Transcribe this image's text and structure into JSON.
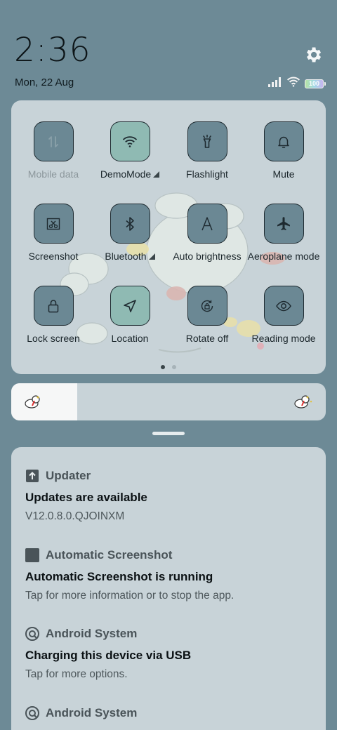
{
  "status_bar": {
    "time": "2:36",
    "date": "Mon, 22 Aug",
    "battery_level": "100",
    "icons": [
      "signal-icon",
      "wifi-icon",
      "battery-icon"
    ]
  },
  "quick_settings": {
    "tiles": [
      {
        "label": "Mobile data",
        "icon": "mobile-data-icon",
        "state": "unavailable",
        "has_menu": false
      },
      {
        "label": "DemoMode",
        "icon": "wifi-icon",
        "state": "on",
        "has_menu": true
      },
      {
        "label": "Flashlight",
        "icon": "flashlight-icon",
        "state": "off",
        "has_menu": false
      },
      {
        "label": "Mute",
        "icon": "bell-icon",
        "state": "off",
        "has_menu": false
      },
      {
        "label": "Screenshot",
        "icon": "screenshot-icon",
        "state": "off",
        "has_menu": false
      },
      {
        "label": "Bluetooth",
        "icon": "bluetooth-icon",
        "state": "off",
        "has_menu": true
      },
      {
        "label": "Auto brightness",
        "icon": "auto-brightness-icon",
        "state": "off",
        "has_menu": false
      },
      {
        "label": "Aeroplane mode",
        "icon": "airplane-icon",
        "state": "off",
        "has_menu": false
      },
      {
        "label": "Lock screen",
        "icon": "lock-icon",
        "state": "off",
        "has_menu": false
      },
      {
        "label": "Location",
        "icon": "location-icon",
        "state": "on",
        "has_menu": false
      },
      {
        "label": "Rotate off",
        "icon": "rotate-lock-icon",
        "state": "off",
        "has_menu": false
      },
      {
        "label": "Reading mode",
        "icon": "eye-icon",
        "state": "off",
        "has_menu": false
      }
    ],
    "page_count": 2,
    "active_page": 1
  },
  "brightness": {
    "level": 0.21
  },
  "notifications": [
    {
      "app": "Updater",
      "icon": "upload-icon",
      "title": "Updates are available",
      "text": "V12.0.8.0.QJOINXM"
    },
    {
      "app": "Automatic Screenshot",
      "icon": "app-square-icon",
      "title": "Automatic Screenshot is running",
      "text": "Tap for more information or to stop the app."
    },
    {
      "app": "Android System",
      "icon": "android-system-icon",
      "title": "Charging this device via USB",
      "text": "Tap for more options."
    },
    {
      "app": "Android System",
      "icon": "android-system-icon",
      "title": "",
      "text": ""
    }
  ],
  "colors": {
    "background": "#6d8a96",
    "panel": "#c8d3d8",
    "tile_off": "#6b8894",
    "tile_on": "#8fbab3"
  }
}
